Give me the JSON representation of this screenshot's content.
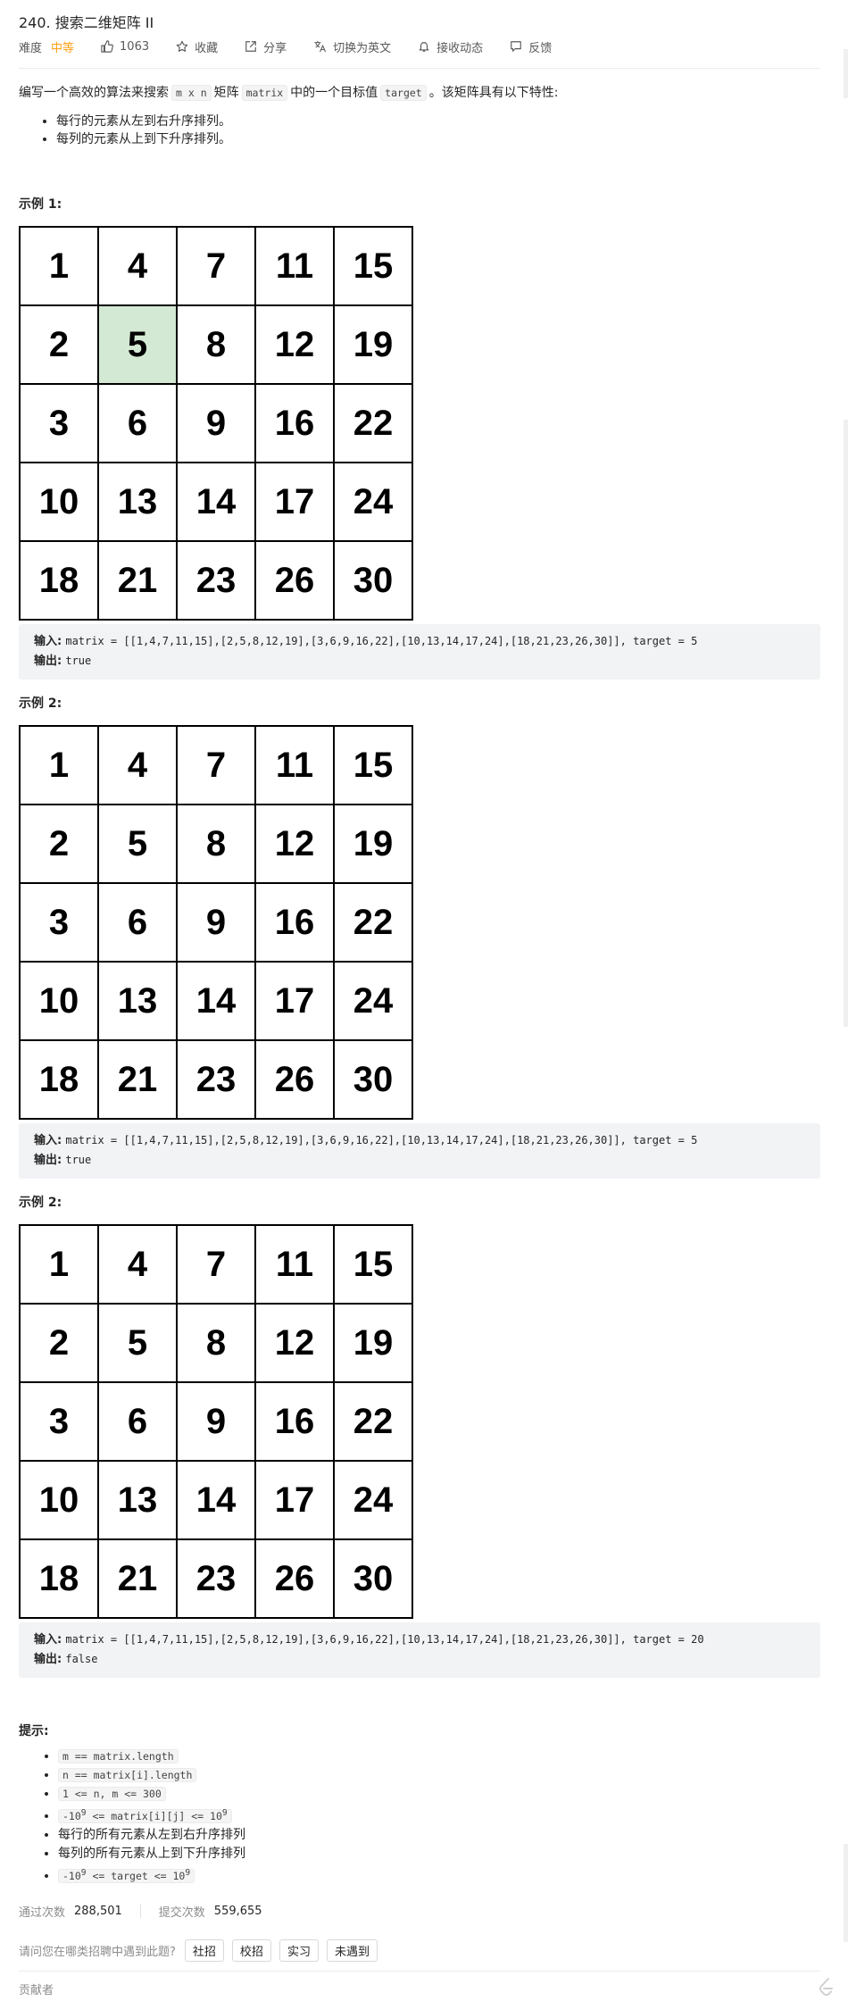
{
  "problem": {
    "title": "240. 搜索二维矩阵 II",
    "difficulty_label": "难度",
    "difficulty": "中等",
    "likes": "1063",
    "favorite": "收藏",
    "share": "分享",
    "switch_lang": "切换为英文",
    "subscribe": "接收动态",
    "feedback": "反馈"
  },
  "description": {
    "intro_before": "编写一个高效的算法来搜索",
    "code_mn": "m x n",
    "word_matrix": "矩阵",
    "code_matrix": "matrix",
    "intro_middle": "中的一个目标值",
    "code_target": "target",
    "intro_after": "。该矩阵具有以下特性:",
    "properties": [
      "每行的元素从左到右升序排列。",
      "每列的元素从上到下升序排列。"
    ]
  },
  "examples": [
    {
      "title": "示例 1:",
      "matrix": [
        [
          1,
          4,
          7,
          11,
          15
        ],
        [
          2,
          5,
          8,
          12,
          19
        ],
        [
          3,
          6,
          9,
          16,
          22
        ],
        [
          10,
          13,
          14,
          17,
          24
        ],
        [
          18,
          21,
          23,
          26,
          30
        ]
      ],
      "highlight": [
        1,
        1
      ],
      "input_label": "输入:",
      "input": "matrix = [[1,4,7,11,15],[2,5,8,12,19],[3,6,9,16,22],[10,13,14,17,24],[18,21,23,26,30]], target = 5",
      "output_label": "输出:",
      "output": "true"
    },
    {
      "title": "示例 2:",
      "matrix": [
        [
          1,
          4,
          7,
          11,
          15
        ],
        [
          2,
          5,
          8,
          12,
          19
        ],
        [
          3,
          6,
          9,
          16,
          22
        ],
        [
          10,
          13,
          14,
          17,
          24
        ],
        [
          18,
          21,
          23,
          26,
          30
        ]
      ],
      "highlight": null,
      "input_label": "输入:",
      "input": "matrix = [[1,4,7,11,15],[2,5,8,12,19],[3,6,9,16,22],[10,13,14,17,24],[18,21,23,26,30]], target = 5",
      "output_label": "输出:",
      "output": "true"
    },
    {
      "title": "示例 2:",
      "matrix": [
        [
          1,
          4,
          7,
          11,
          15
        ],
        [
          2,
          5,
          8,
          12,
          19
        ],
        [
          3,
          6,
          9,
          16,
          22
        ],
        [
          10,
          13,
          14,
          17,
          24
        ],
        [
          18,
          21,
          23,
          26,
          30
        ]
      ],
      "highlight": null,
      "input_label": "输入:",
      "input": "matrix = [[1,4,7,11,15],[2,5,8,12,19],[3,6,9,16,22],[10,13,14,17,24],[18,21,23,26,30]], target = 20",
      "output_label": "输出:",
      "output": "false"
    }
  ],
  "hints": {
    "title": "提示:",
    "items": [
      {
        "code": "m == matrix.length"
      },
      {
        "code": "n == matrix[i].length"
      },
      {
        "code": "1 <= n, m <= 300"
      },
      {
        "code_before": "-10",
        "sup1": "9",
        "code_middle": " <= matrix[i][j] <= 10",
        "sup2": "9"
      },
      {
        "text": "每行的所有元素从左到右升序排列"
      },
      {
        "text": "每列的所有元素从上到下升序排列"
      },
      {
        "code_before": "-10",
        "sup1": "9",
        "code_middle": " <= target <= 10",
        "sup2": "9"
      }
    ]
  },
  "stats": {
    "accepted_label": "通过次数",
    "accepted": "288,501",
    "submitted_label": "提交次数",
    "submitted": "559,655"
  },
  "company": {
    "question": "请问您在哪类招聘中遇到此题?",
    "tags": [
      "社招",
      "校招",
      "实习",
      "未遇到"
    ]
  },
  "contributors_label": "贡献者",
  "colors": {
    "difficulty": "#ffa116",
    "highlight_cell": "#d4e9d4",
    "example_bg": "#f2f3f5"
  }
}
